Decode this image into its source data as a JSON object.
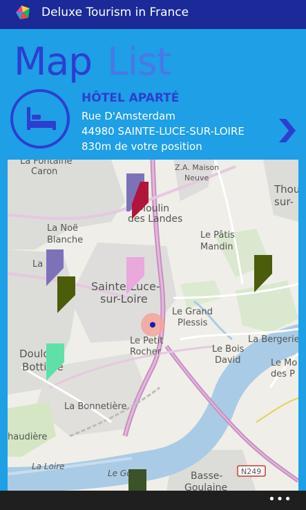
{
  "app": {
    "title": "Deluxe Tourism in France",
    "icon": "app-logo-icon"
  },
  "pivot": {
    "tabs": [
      {
        "label": "Map",
        "active": true
      },
      {
        "label": "List",
        "active": false
      }
    ]
  },
  "hotel": {
    "name": "HÔTEL APARTÉ",
    "street": "Rue D'Amsterdam",
    "city_line": "44980 SAINTE-LUCE-SUR-LOIRE",
    "distance": "830m de votre position",
    "icon": "bed-icon",
    "next_icon": "chevron-right-icon"
  },
  "map": {
    "labels": {
      "la_fontaine_caron_1": "La Fontaine",
      "la_fontaine_caron_2": "Caron",
      "za_maison_neuve_1": "Z.A. Maison",
      "za_maison_neuve_2": "Neuve",
      "thouare_1": "Thou",
      "thouare_2": "sur-",
      "moulin_1": "Moulin",
      "moulin_2": "des Landes",
      "la_noe_blanche_1": "La Noë",
      "la_noe_blanche_2": "Blanche",
      "patis_mandin_1": "Le Pâtis",
      "patis_mandin_2": "Mandin",
      "la_lande": "La  nde",
      "sainte_luce_1": "Sainte-Luce-",
      "sainte_luce_2": "sur-Loire",
      "grand_plessis_1": "Le Grand",
      "grand_plessis_2": "Plessis",
      "la_bergerie": "La Bergerie",
      "petit_rocher_1": "Le Petit",
      "petit_rocher_2": "Rocher",
      "bois_david_1": "Le Bois",
      "bois_david_2": "David",
      "le_mo_1": "Le Mo",
      "le_mo_2": "des P",
      "doulon_1": "Doulon-",
      "doulon_2": "Bottière",
      "la_bonnetiere": "La Bonnetière",
      "chaudiere": "haudière",
      "la_loire": "La Loire",
      "le_goulau": "Le Go    au",
      "basse_goulaine_1": "Basse-",
      "basse_goulaine_2": "Goulaine",
      "road_n249": "N249"
    },
    "markers": [
      {
        "name": "marker-purple-1",
        "color": "#7d72b8"
      },
      {
        "name": "marker-crimson",
        "color": "#b0163a"
      },
      {
        "name": "marker-purple-2",
        "color": "#7d72b8"
      },
      {
        "name": "marker-olive-1",
        "color": "#4b5c0b"
      },
      {
        "name": "marker-pink",
        "color": "#eaa8dc"
      },
      {
        "name": "marker-olive-2",
        "color": "#4b5c0b"
      },
      {
        "name": "marker-mint",
        "color": "#5fe0a8"
      },
      {
        "name": "marker-darkgreen",
        "color": "#3c5229"
      }
    ],
    "current_location_icon": "current-location-icon"
  },
  "appbar": {
    "more_label": "•••"
  },
  "colors": {
    "accent": "#2c3fcf",
    "background": "#1e9fe6",
    "titlebar": "#1b2a98"
  }
}
